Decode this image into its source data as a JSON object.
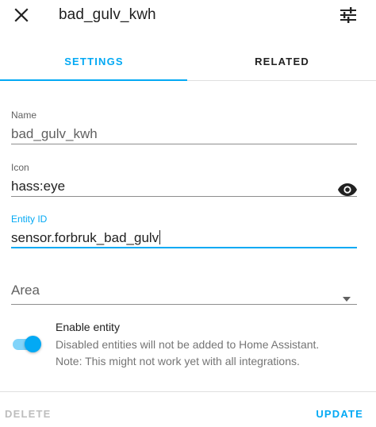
{
  "dialog": {
    "title": "bad_gulv_kwh",
    "icons": {
      "close": "close-icon",
      "settings": "tune-icon"
    }
  },
  "tabs": [
    {
      "label": "SETTINGS",
      "active": true
    },
    {
      "label": "RELATED",
      "active": false
    }
  ],
  "fields": {
    "name": {
      "label": "Name",
      "value": "bad_gulv_kwh"
    },
    "icon": {
      "label": "Icon",
      "value": "hass:eye",
      "preview_icon": "eye-icon"
    },
    "entity_id": {
      "label": "Entity ID",
      "value": "sensor.forbruk_bad_gulv"
    },
    "area": {
      "placeholder": "Area"
    }
  },
  "enable_entity": {
    "title": "Enable entity",
    "description_1": "Disabled entities will not be added to Home Assistant.",
    "description_2": "Note: This might not work yet with all integrations.",
    "enabled": true
  },
  "actions": {
    "delete": "DELETE",
    "update": "UPDATE"
  },
  "colors": {
    "accent": "#03a9f4",
    "text": "#212121",
    "secondary": "#616161",
    "disabled": "#bdbdbd"
  }
}
